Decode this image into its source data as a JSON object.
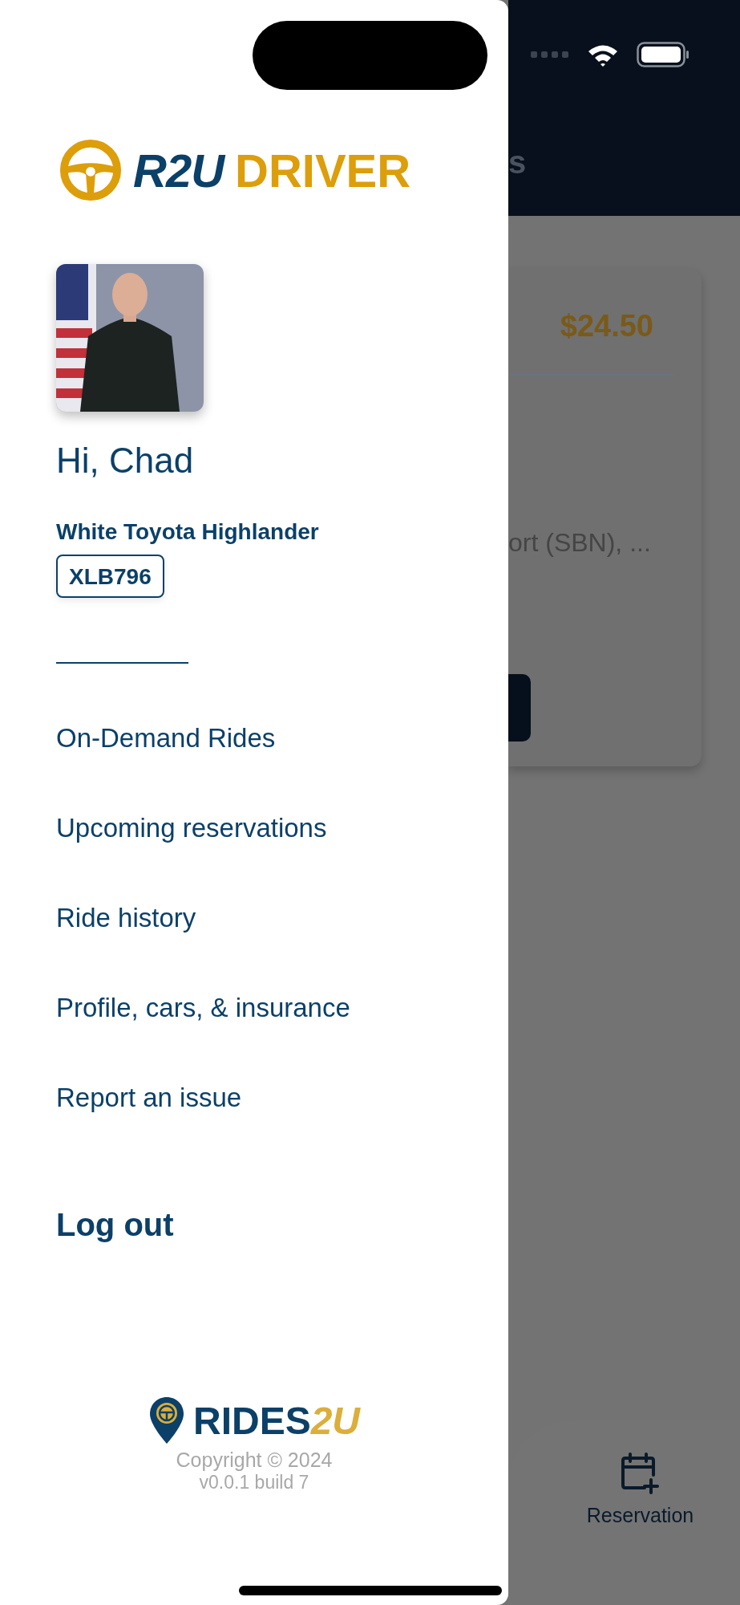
{
  "drawer": {
    "logo": {
      "brand": "R2U",
      "suffix": "DRIVER"
    },
    "profile": {
      "greeting": "Hi, Chad",
      "car": "White Toyota Highlander",
      "plate": "XLB796"
    },
    "menu": [
      {
        "label": "On-Demand Rides"
      },
      {
        "label": "Upcoming reservations"
      },
      {
        "label": "Ride history"
      },
      {
        "label": "Profile, cars, & insurance"
      },
      {
        "label": "Report an issue"
      }
    ],
    "logout": "Log out",
    "footer": {
      "brand": "RIDES",
      "brand_accent": "2U",
      "copyright": "Copyright © 2024",
      "version": "v0.0.1 build 7"
    }
  },
  "background": {
    "header_title": "s",
    "card": {
      "price": "$24.50",
      "address": "ort (SBN), ..."
    },
    "tab_bar": {
      "items": [
        {
          "label": "Reservation"
        }
      ]
    }
  }
}
